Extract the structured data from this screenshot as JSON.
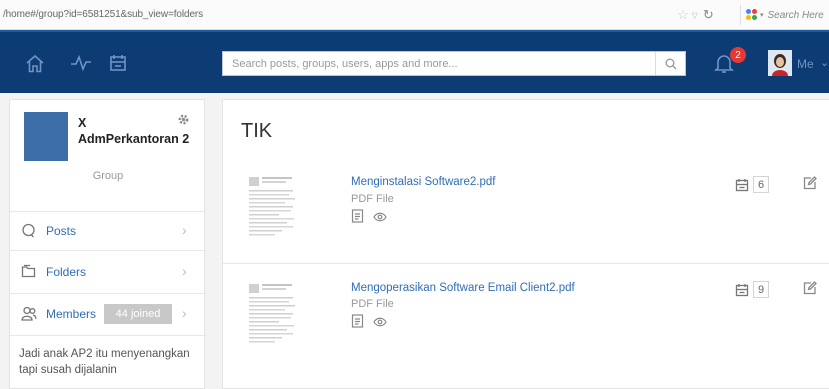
{
  "browser": {
    "url": "/home#/group?id=6581251&sub_view=folders",
    "search_placeholder": "Search Here"
  },
  "topbar": {
    "search_placeholder": "Search posts, groups, users, apps and more...",
    "notification_count": "2",
    "user_label": "Me",
    "icons": [
      "home-icon",
      "activity-icon",
      "calendar-icon",
      "search-icon",
      "bell-icon"
    ],
    "colors": {
      "bar": "#0d3b73",
      "badge": "#e53935",
      "link": "#2f6db5"
    }
  },
  "group": {
    "name": "X AdmPerkantoran 2",
    "type": "Group",
    "nav": [
      {
        "label": "Posts",
        "icon": "chat-bubble-icon"
      },
      {
        "label": "Folders",
        "icon": "folder-icon"
      },
      {
        "label": "Members",
        "icon": "members-icon",
        "badge": "44 joined"
      }
    ],
    "about": "Jadi anak AP2 itu menyenangkan tapi susah dijalanin"
  },
  "folder": {
    "title": "TIK",
    "files": [
      {
        "name": "Menginstalasi Software2.pdf",
        "type": "PDF File",
        "count": "6"
      },
      {
        "name": "Mengoperasikan Software Email Client2.pdf",
        "type": "PDF File",
        "count": "9"
      }
    ]
  }
}
